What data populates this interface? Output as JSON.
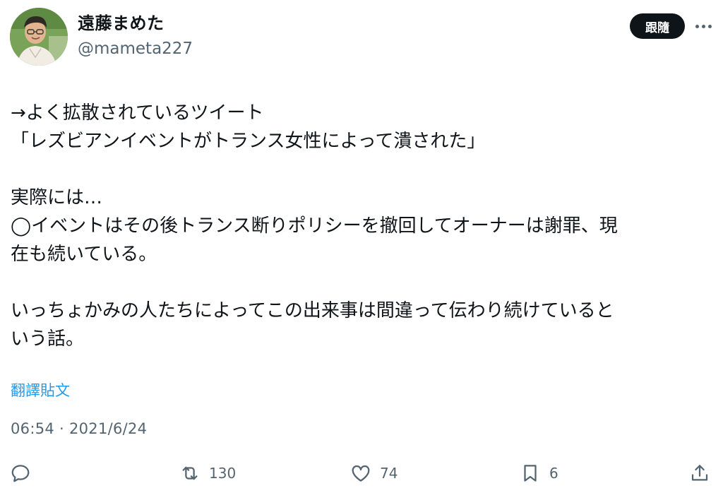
{
  "author": {
    "display_name": "遠藤まめた",
    "handle": "@mameta227"
  },
  "header": {
    "follow_label": "跟隨"
  },
  "tweet": {
    "lines": [
      "→よく拡散されているツイート",
      "「レズビアンイベントがトランス女性によって潰された」",
      "",
      "実際には…",
      "◯イベントはその後トランス断りポリシーを撤回してオーナーは謝罪、現",
      "在も続いている。",
      "",
      "いっちょかみの人たちによってこの出来事は間違って伝わり続けていると",
      "いう話。"
    ],
    "translate_label": "翻譯貼文",
    "time": "06:54",
    "separator": " · ",
    "date": "2021/6/24"
  },
  "actions": {
    "reply_icon": "reply-icon",
    "retweet_icon": "retweet-icon",
    "retweet_count": "130",
    "like_icon": "heart-icon",
    "like_count": "74",
    "bookmark_icon": "bookmark-icon",
    "bookmark_count": "6",
    "share_icon": "share-icon"
  },
  "colors": {
    "text": "#0f1419",
    "secondary": "#536471",
    "link": "#1d9bf0",
    "button_bg": "#0f1419"
  }
}
